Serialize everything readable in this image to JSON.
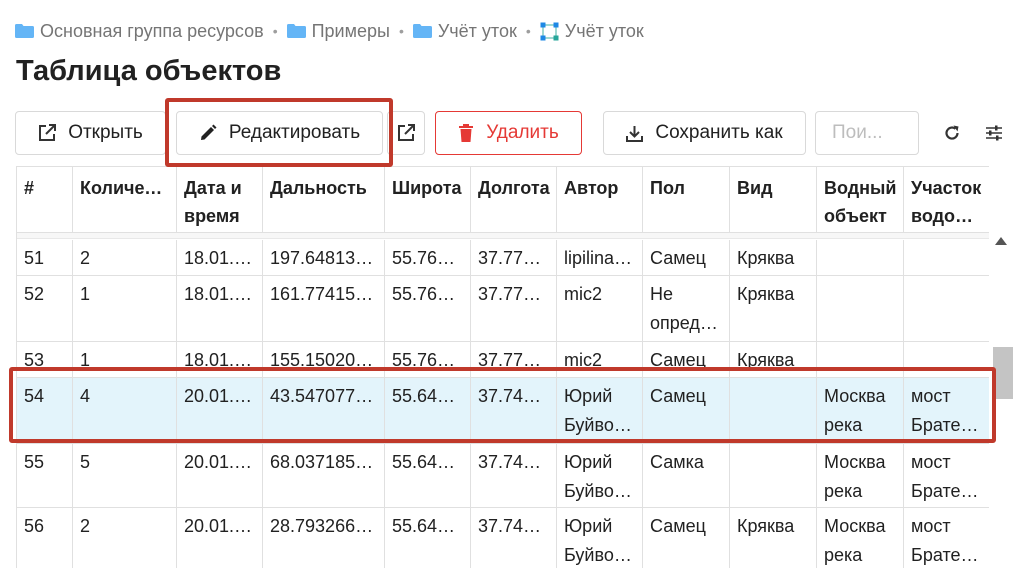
{
  "breadcrumb": [
    {
      "label": "Основная группа ресурсов",
      "icon": "folder-icon"
    },
    {
      "label": "Примеры",
      "icon": "folder-icon"
    },
    {
      "label": "Учёт уток",
      "icon": "folder-icon"
    },
    {
      "label": "Учёт уток",
      "icon": "vector-layer-icon"
    }
  ],
  "breadcrumb_separator": "•",
  "page_title": "Таблица объектов",
  "toolbar": {
    "open_label": "Открыть",
    "edit_label": "Редактировать",
    "delete_label": "Удалить",
    "save_as_label": "Сохранить как",
    "search_placeholder": "Пои..."
  },
  "colors": {
    "accent_red": "#e53935",
    "annotation_red": "#c0392b",
    "selected_row": "#e3f4fb",
    "folder_blue": "#64b5f6"
  },
  "table": {
    "columns": [
      "#",
      "Количес…",
      "Дата и время",
      "Дальность",
      "Широта",
      "Долгота",
      "Автор",
      "Пол",
      "Вид",
      "Водный объект",
      "Участок водоё…"
    ],
    "rows": [
      {
        "id": "51",
        "count": "2",
        "date": "18.01.…",
        "distance": "197.64813…",
        "lat": "55.764…",
        "lon": "37.776…",
        "author": [
          "lipilina.…"
        ],
        "sex": [
          "Самец"
        ],
        "species": "Кряква",
        "water": [
          ""
        ],
        "area": [
          ""
        ]
      },
      {
        "id": "52",
        "count": "1",
        "date": "18.01.…",
        "distance": "161.77415…",
        "lat": "55.763…",
        "lon": "37.776…",
        "author": [
          "mic2"
        ],
        "sex": [
          "Не",
          "опред…"
        ],
        "species": "Кряква",
        "water": [
          ""
        ],
        "area": [
          ""
        ]
      },
      {
        "id": "53",
        "count": "1",
        "date": "18.01.…",
        "distance": "155.15020…",
        "lat": "55.763…",
        "lon": "37.776…",
        "author": [
          "mic2"
        ],
        "sex": [
          "Самец"
        ],
        "species": "Кряква",
        "water": [
          ""
        ],
        "area": [
          ""
        ]
      },
      {
        "id": "54",
        "count": "4",
        "date": "20.01.…",
        "distance": "43.547077…",
        "lat": "55.640…",
        "lon": "37.745…",
        "author": [
          "Юрий",
          "Буйво…"
        ],
        "sex": [
          "Самец"
        ],
        "species": "",
        "water": [
          "Москва",
          "река"
        ],
        "area": [
          "мост",
          "Братее…"
        ],
        "selected": true
      },
      {
        "id": "55",
        "count": "5",
        "date": "20.01.…",
        "distance": "68.037185…",
        "lat": "55.640…",
        "lon": "37.745…",
        "author": [
          "Юрий",
          "Буйво…"
        ],
        "sex": [
          "Самка"
        ],
        "species": "",
        "water": [
          "Москва",
          "река"
        ],
        "area": [
          "мост",
          "Братее…"
        ]
      },
      {
        "id": "56",
        "count": "2",
        "date": "20.01.…",
        "distance": "28.793266…",
        "lat": "55.640…",
        "lon": "37.742…",
        "author": [
          "Юрий",
          "Буйво…"
        ],
        "sex": [
          "Самец"
        ],
        "species": "Кряква",
        "water": [
          "Москва",
          "река"
        ],
        "area": [
          "мост",
          "Братее…"
        ]
      }
    ]
  }
}
